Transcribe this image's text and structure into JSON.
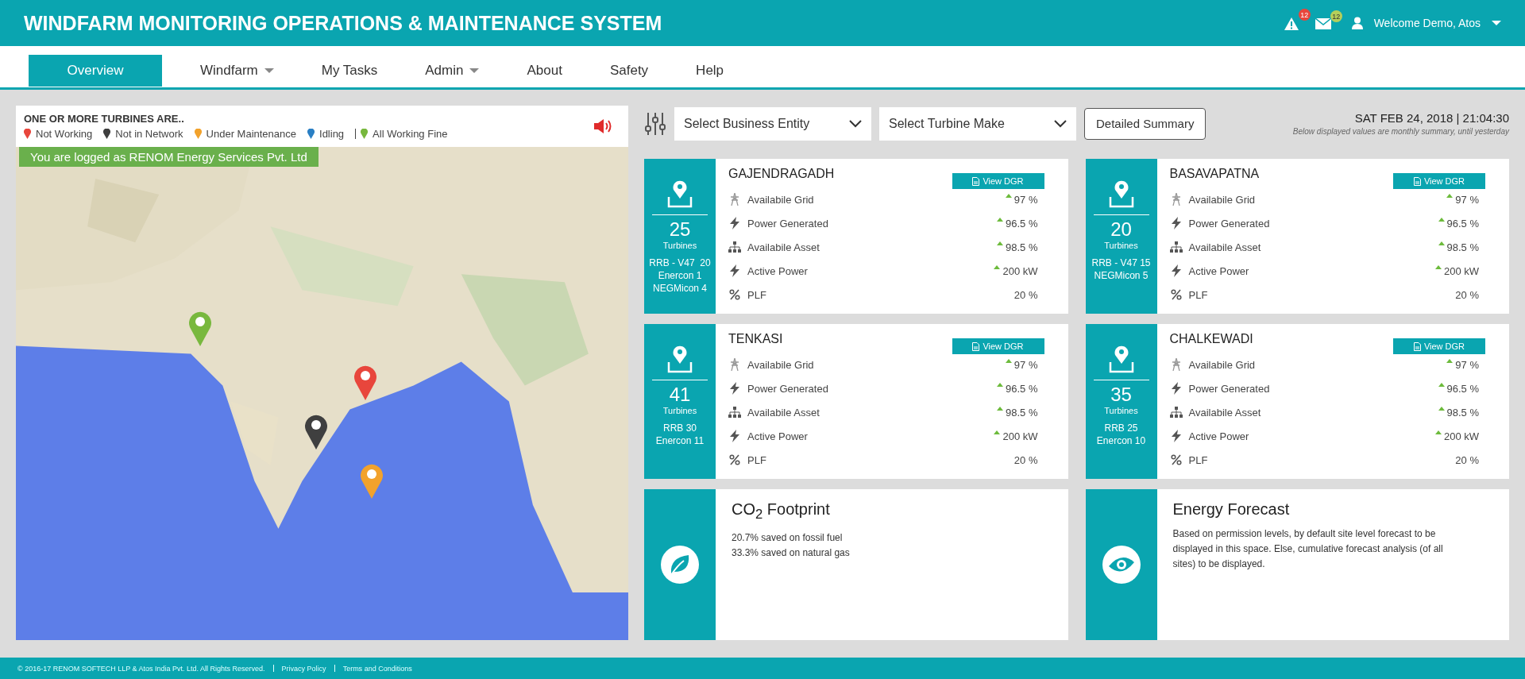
{
  "header": {
    "title": "WINDFARM MONITORING OPERATIONS & MAINTENANCE SYSTEM",
    "alerts": "12",
    "messages": "12",
    "user": "Welcome Demo, Atos"
  },
  "nav": [
    {
      "label": "Overview",
      "selected": true,
      "has_menu": false
    },
    {
      "label": "Windfarm",
      "selected": false,
      "has_menu": true
    },
    {
      "label": "My Tasks",
      "selected": false,
      "has_menu": false
    },
    {
      "label": "Admin",
      "selected": false,
      "has_menu": true
    },
    {
      "label": "About",
      "selected": false,
      "has_menu": false
    },
    {
      "label": "Safety",
      "selected": false,
      "has_menu": false
    },
    {
      "label": "Help",
      "selected": false,
      "has_menu": false
    }
  ],
  "map_panel": {
    "heading": "ONE OR MORE TURBINES ARE..",
    "legend": [
      {
        "label": "Not Working",
        "color": "#e8463c"
      },
      {
        "label": "Not in Network",
        "color": "#3f3f3f"
      },
      {
        "label": "Under Maintenance",
        "color": "#f2a22c"
      },
      {
        "label": "Idling",
        "color": "#2a7fc4"
      },
      {
        "label": "All Working Fine",
        "color": "#78b83e"
      }
    ],
    "login_banner": "You are logged as RENOM Energy Services Pvt. Ltd",
    "markers": [
      {
        "color": "#78b83e"
      },
      {
        "color": "#e8463c"
      },
      {
        "color": "#3f3f3f"
      },
      {
        "color": "#f2a22c"
      }
    ]
  },
  "toolbar": {
    "dropdowns": [
      "Select Business Entity",
      "Select Turbine Make"
    ],
    "button": "Detailed Summary",
    "datetime": "SAT FEB 24, 2018 | 21:04:30",
    "note": "Below displayed values are monthly summary, until yesterday"
  },
  "sites": [
    {
      "name": "GAJENDRAGADH",
      "count": "25",
      "unit": "Turbines",
      "makes": [
        "RRB - V47  20",
        "Enercon 1",
        "NEGMicon 4"
      ],
      "button": "View DGR",
      "metrics": [
        {
          "kind": "grid",
          "label": "Availabile Grid",
          "trend_up": true,
          "value": "97 %"
        },
        {
          "kind": "power",
          "label": "Power Generated",
          "trend_up": true,
          "value": "96.5 %"
        },
        {
          "kind": "asset",
          "label": "Availabile Asset",
          "trend_up": true,
          "value": "98.5 %"
        },
        {
          "kind": "power",
          "label": "Active Power",
          "trend_up": true,
          "value": "200 kW"
        },
        {
          "kind": "percent",
          "label": "PLF",
          "trend_up": false,
          "value": "20 %"
        }
      ]
    },
    {
      "name": "BASAVAPATNA",
      "count": "20",
      "unit": "Turbines",
      "makes": [
        "RRB - V47 15",
        "NEGMicon 5"
      ],
      "button": "View DGR",
      "metrics": [
        {
          "kind": "grid",
          "label": "Availabile Grid",
          "trend_up": true,
          "value": "97 %"
        },
        {
          "kind": "power",
          "label": "Power Generated",
          "trend_up": true,
          "value": "96.5 %"
        },
        {
          "kind": "asset",
          "label": "Availabile Asset",
          "trend_up": true,
          "value": "98.5 %"
        },
        {
          "kind": "power",
          "label": "Active Power",
          "trend_up": true,
          "value": "200 kW"
        },
        {
          "kind": "percent",
          "label": "PLF",
          "trend_up": false,
          "value": "20 %"
        }
      ]
    },
    {
      "name": "TENKASI",
      "count": "41",
      "unit": "Turbines",
      "makes": [
        "RRB 30",
        "Enercon 11"
      ],
      "button": "View DGR",
      "metrics": [
        {
          "kind": "grid",
          "label": "Availabile Grid",
          "trend_up": true,
          "value": "97 %"
        },
        {
          "kind": "power",
          "label": "Power Generated",
          "trend_up": true,
          "value": "96.5 %"
        },
        {
          "kind": "asset",
          "label": "Availabile Asset",
          "trend_up": true,
          "value": "98.5 %"
        },
        {
          "kind": "power",
          "label": "Active Power",
          "trend_up": true,
          "value": "200 kW"
        },
        {
          "kind": "percent",
          "label": "PLF",
          "trend_up": false,
          "value": "20 %"
        }
      ]
    },
    {
      "name": "CHALKEWADI",
      "count": "35",
      "unit": "Turbines",
      "makes": [
        "RRB 25",
        "Enercon 10"
      ],
      "button": "View DGR",
      "metrics": [
        {
          "kind": "grid",
          "label": "Availabile Grid",
          "trend_up": true,
          "value": "97 %"
        },
        {
          "kind": "power",
          "label": "Power Generated",
          "trend_up": true,
          "value": "96.5 %"
        },
        {
          "kind": "asset",
          "label": "Availabile Asset",
          "trend_up": true,
          "value": "98.5 %"
        },
        {
          "kind": "power",
          "label": "Active Power",
          "trend_up": true,
          "value": "200 kW"
        },
        {
          "kind": "percent",
          "label": "PLF",
          "trend_up": false,
          "value": "20 %"
        }
      ]
    }
  ],
  "info_cards": [
    {
      "kind": "leaf",
      "title": "CO$_{2}$ Footprint",
      "lines": [
        "20.7% saved on fossil fuel",
        "33.3% saved on natural gas"
      ]
    },
    {
      "kind": "eye",
      "title": "Energy Forecast",
      "lines": [
        "Based on permission levels, by default site level forecast to be displayed in this space. Else, cumulative forecast analysis (of all sites) to be displayed."
      ]
    }
  ],
  "footer": {
    "copyright": "© 2016-17 RENOM SOFTECH LLP & Atos India Pvt. Ltd. All Rights Reserved.",
    "links": [
      "Privacy Policy",
      "Terms and Conditions"
    ]
  }
}
